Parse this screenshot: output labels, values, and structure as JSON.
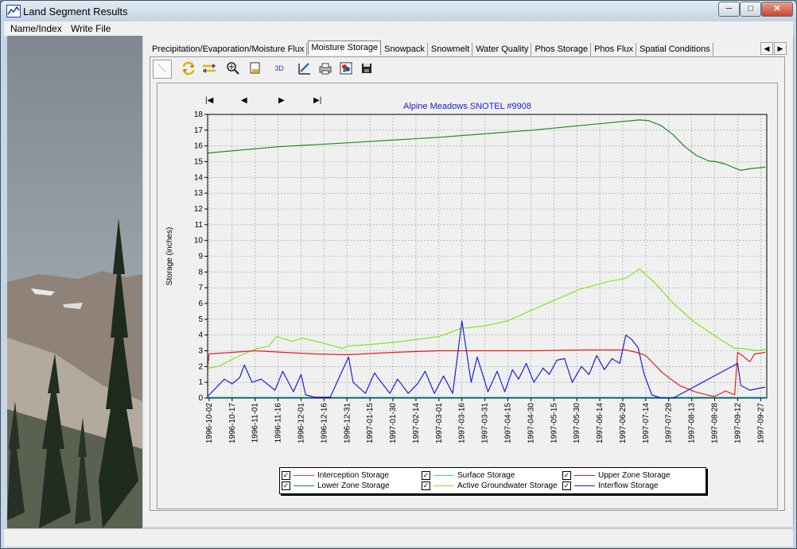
{
  "window": {
    "title": "Land Segment Results",
    "buttons": {
      "minimize": "─",
      "maximize": "□",
      "close": "✕"
    }
  },
  "menu": [
    "Name/Index",
    "Write File"
  ],
  "tabs": [
    {
      "label": "Precipitation/Evaporation/Moisture Flux",
      "active": false
    },
    {
      "label": "Moisture Storage",
      "active": true
    },
    {
      "label": "Snowpack",
      "active": false
    },
    {
      "label": "Snowmelt",
      "active": false
    },
    {
      "label": "Water Quality",
      "active": false
    },
    {
      "label": "Phos Storage",
      "active": false
    },
    {
      "label": "Phos Flux",
      "active": false
    },
    {
      "label": "Spatial Conditions",
      "active": false
    }
  ],
  "tab_scroll": [
    "◀",
    "▶"
  ],
  "toolbar_icons": [
    "pointer-icon",
    "refresh-icon",
    "axis-scale-icon",
    "zoom-icon",
    "page-setup-icon",
    "3d-icon",
    "edit-chart-icon",
    "print-icon",
    "color-palette-icon",
    "save-icon"
  ],
  "toolbar_3d_label": "3D",
  "nav": {
    "first": "|◀",
    "prev": "◀",
    "next": "▶",
    "last": "▶|"
  },
  "chart_data": {
    "type": "line",
    "title": "Alpine Meadows SNOTEL #9908",
    "xlabel": "",
    "ylabel": "Storage (inches)",
    "ylim": [
      0,
      18
    ],
    "yticks": [
      "0",
      "1",
      "2",
      "3",
      "4",
      "5",
      "6",
      "7",
      "8",
      "9",
      "10",
      "11",
      "12",
      "13",
      "14",
      "15",
      "16",
      "17",
      "18"
    ],
    "xlim": [
      "1996-10-01",
      "1997-10-01"
    ],
    "xticks": [
      "1996-10-02",
      "1996-10-17",
      "1996-11-01",
      "1996-11-16",
      "1996-12-01",
      "1996-12-16",
      "1996-12-31",
      "1997-01-15",
      "1997-01-30",
      "1997-02-14",
      "1997-03-01",
      "1997-03-16",
      "1997-03-31",
      "1997-04-15",
      "1997-04-30",
      "1997-05-15",
      "1997-05-30",
      "1997-06-14",
      "1997-06-29",
      "1997-07-14",
      "1997-07-29",
      "1997-08-13",
      "1997-08-28",
      "1997-09-12",
      "1997-09-27"
    ],
    "grid": true,
    "legend_position": "bottom-center",
    "series": [
      {
        "name": "Interception Storage",
        "color": "#e61ee6",
        "x": [
          "1996-10-01",
          "1997-09-30"
        ],
        "y": [
          0.02,
          0.02
        ]
      },
      {
        "name": "Lower Zone Storage",
        "color": "#1e8a1e",
        "x": [
          "1996-10-01",
          "1996-11-16",
          "1997-01-01",
          "1997-03-01",
          "1997-05-01",
          "1997-07-10",
          "1997-07-16",
          "1997-07-24",
          "1997-08-01",
          "1997-08-08",
          "1997-08-16",
          "1997-08-24",
          "1997-08-29",
          "1997-09-04",
          "1997-09-10",
          "1997-09-14",
          "1997-09-20",
          "1997-09-30"
        ],
        "y": [
          15.55,
          15.95,
          16.2,
          16.55,
          17.0,
          17.65,
          17.6,
          17.3,
          16.7,
          16.0,
          15.4,
          15.05,
          15.0,
          14.85,
          14.6,
          14.45,
          14.55,
          14.65
        ]
      },
      {
        "name": "Surface Storage",
        "color": "#2ad6e0",
        "x": [
          "1996-10-01",
          "1997-09-30"
        ],
        "y": [
          0.05,
          0.05
        ]
      },
      {
        "name": "Active Groundwater Storage",
        "color": "#7ee622",
        "x": [
          "1996-10-01",
          "1996-10-08",
          "1996-10-20",
          "1996-11-01",
          "1996-11-10",
          "1996-11-15",
          "1996-11-25",
          "1996-12-02",
          "1996-12-15",
          "1996-12-28",
          "1996-12-31",
          "1997-01-15",
          "1997-02-01",
          "1997-03-01",
          "1997-03-15",
          "1997-04-01",
          "1997-04-15",
          "1997-05-01",
          "1997-05-20",
          "1997-06-01",
          "1997-06-20",
          "1997-07-01",
          "1997-07-10",
          "1997-07-20",
          "1997-08-01",
          "1997-08-15",
          "1997-09-01",
          "1997-09-10",
          "1997-09-15",
          "1997-09-25",
          "1997-09-30"
        ],
        "y": [
          1.9,
          2.0,
          2.6,
          3.1,
          3.3,
          3.9,
          3.6,
          3.8,
          3.5,
          3.15,
          3.3,
          3.4,
          3.55,
          3.9,
          4.4,
          4.6,
          4.9,
          5.6,
          6.4,
          6.9,
          7.4,
          7.6,
          8.2,
          7.3,
          6.0,
          4.8,
          3.7,
          3.15,
          3.15,
          3.0,
          3.1
        ]
      },
      {
        "name": "Upper Zone Storage",
        "color": "#e61e1e",
        "x": [
          "1996-10-01",
          "1996-10-02",
          "1996-11-01",
          "1996-11-20",
          "1996-12-10",
          "1996-12-31",
          "1997-01-30",
          "1997-03-01",
          "1997-04-01",
          "1997-05-01",
          "1997-06-01",
          "1997-07-01",
          "1997-07-08",
          "1997-07-14",
          "1997-07-25",
          "1997-08-05",
          "1997-08-15",
          "1997-08-25",
          "1997-08-28",
          "1997-09-04",
          "1997-09-10",
          "1997-09-12",
          "1997-09-15",
          "1997-09-20",
          "1997-09-23",
          "1997-09-30"
        ],
        "y": [
          2.1,
          2.8,
          3.0,
          2.9,
          2.8,
          2.75,
          2.9,
          3.0,
          3.0,
          3.0,
          3.05,
          3.05,
          2.9,
          2.7,
          1.6,
          0.8,
          0.4,
          0.15,
          0.1,
          0.45,
          0.2,
          2.9,
          2.7,
          2.3,
          2.8,
          2.9
        ]
      },
      {
        "name": "Interflow Storage",
        "color": "#1e1edc",
        "x": [
          "1996-10-01",
          "1996-10-12",
          "1996-10-17",
          "1996-10-22",
          "1996-10-25",
          "1996-10-30",
          "1996-11-05",
          "1996-11-14",
          "1996-11-19",
          "1996-11-26",
          "1996-12-01",
          "1996-12-04",
          "1996-12-10",
          "1996-12-20",
          "1997-01-01",
          "1997-01-04",
          "1997-01-12",
          "1997-01-18",
          "1997-01-20",
          "1997-01-28",
          "1997-02-02",
          "1997-02-09",
          "1997-02-15",
          "1997-02-20",
          "1997-02-26",
          "1997-03-04",
          "1997-03-10",
          "1997-03-16",
          "1997-03-22",
          "1997-03-26",
          "1997-04-02",
          "1997-04-08",
          "1997-04-13",
          "1997-04-18",
          "1997-04-22",
          "1997-04-27",
          "1997-05-02",
          "1997-05-08",
          "1997-05-12",
          "1997-05-17",
          "1997-05-22",
          "1997-05-27",
          "1997-06-02",
          "1997-06-07",
          "1997-06-12",
          "1997-06-17",
          "1997-06-22",
          "1997-06-27",
          "1997-07-01",
          "1997-07-05",
          "1997-07-09",
          "1997-07-13",
          "1997-07-18",
          "1997-07-24",
          "1997-08-01",
          "1997-09-12",
          "1997-09-14",
          "1997-09-20",
          "1997-09-30"
        ],
        "y": [
          0.1,
          1.2,
          0.9,
          1.3,
          2.1,
          1.0,
          1.2,
          0.5,
          1.7,
          0.4,
          1.5,
          0.2,
          0.05,
          0.05,
          2.6,
          1.0,
          0.3,
          1.6,
          1.3,
          0.3,
          1.2,
          0.3,
          0.9,
          1.7,
          0.3,
          1.4,
          0.3,
          4.9,
          1.0,
          2.6,
          0.4,
          1.7,
          0.4,
          1.8,
          1.2,
          2.2,
          1.0,
          1.9,
          1.5,
          2.4,
          2.5,
          1.0,
          2.0,
          1.5,
          2.7,
          1.8,
          2.5,
          2.2,
          4.0,
          3.7,
          3.2,
          1.5,
          0.2,
          0.0,
          0.0,
          2.2,
          0.8,
          0.5,
          0.7
        ]
      }
    ]
  }
}
